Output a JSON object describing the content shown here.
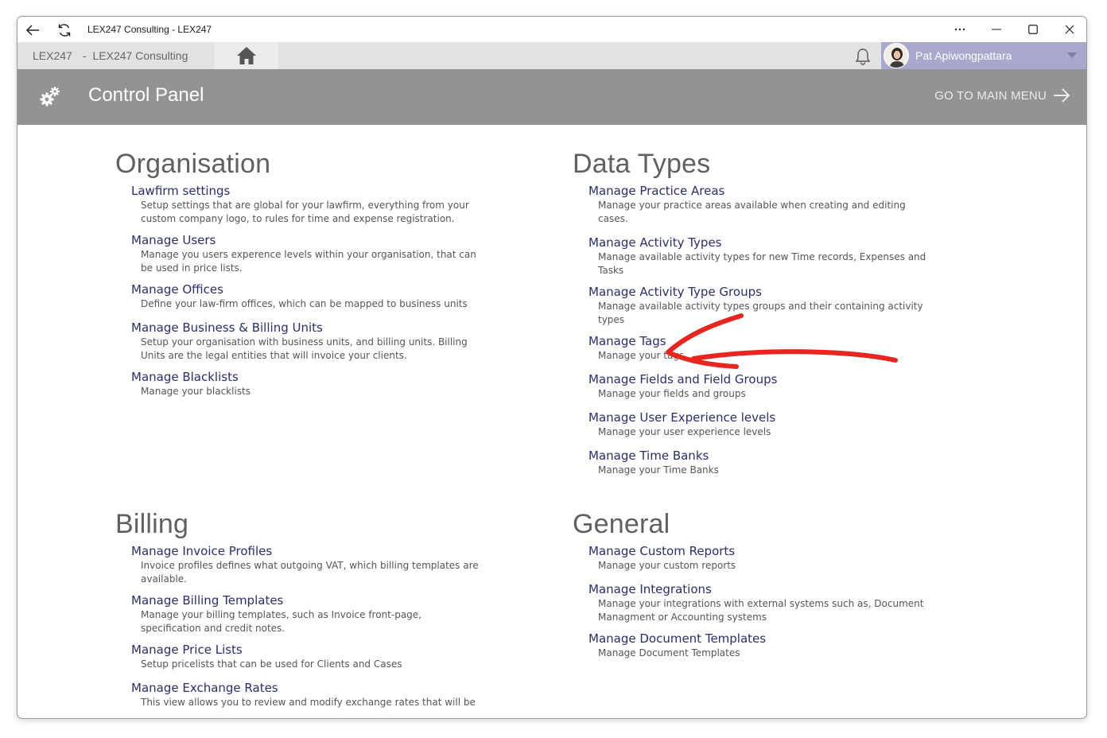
{
  "window": {
    "title": "LEX247 Consulting - LEX247"
  },
  "nav": {
    "breadcrumb_app": "LEX247",
    "breadcrumb_sep": "-",
    "breadcrumb_org": "LEX247 Consulting",
    "user_name": "Pat Apiwongpattara"
  },
  "header": {
    "title": "Control Panel",
    "go_main_menu": "GO TO MAIN MENU"
  },
  "colors": {
    "header_bg": "#939393",
    "user_box_bg": "#a8a8cf",
    "link": "#2a2e6a",
    "annotation": "#e8251e"
  },
  "sections": {
    "organisation": {
      "title": "Organisation",
      "items": [
        {
          "title": "Lawfirm settings",
          "desc": "Setup settings that are global for your lawfirm, everything from your custom company logo, to rules for time and expense registration."
        },
        {
          "title": "Manage Users",
          "desc": "Manage you users experence levels within your organisation, that can be used in price lists."
        },
        {
          "title": "Manage Offices",
          "desc": "Define your law-firm offices, which can be mapped to business units"
        },
        {
          "title": "Manage Business & Billing Units",
          "desc": "Setup your organisation with business units, and billing units. Billing Units are the legal entities that will invoice your clients."
        },
        {
          "title": "Manage Blacklists",
          "desc": "Manage your blacklists"
        }
      ]
    },
    "data_types": {
      "title": "Data Types",
      "items": [
        {
          "title": "Manage Practice Areas",
          "desc": "Manage your practice areas available when creating and editing cases."
        },
        {
          "title": "Manage Activity Types",
          "desc": "Manage available activity types for new Time records, Expenses and Tasks"
        },
        {
          "title": "Manage Activity Type Groups",
          "desc": "Manage available activity types groups and their containing activity types"
        },
        {
          "title": "Manage Tags",
          "desc": "Manage your tags"
        },
        {
          "title": "Manage Fields and Field Groups",
          "desc": "Manage your fields and groups"
        },
        {
          "title": "Manage User Experience levels",
          "desc": "Manage your user experience levels"
        },
        {
          "title": "Manage Time Banks",
          "desc": "Manage your Time Banks"
        }
      ]
    },
    "billing": {
      "title": "Billing",
      "items": [
        {
          "title": "Manage Invoice Profiles",
          "desc": "Invoice profiles defines what outgoing VAT, which billing templates are available."
        },
        {
          "title": "Manage Billing Templates",
          "desc": "Manage your billing templates, such as Invoice front-page, specification and credit notes."
        },
        {
          "title": "Manage Price Lists",
          "desc": "Setup pricelists that can be used for Clients and Cases"
        },
        {
          "title": "Manage Exchange Rates",
          "desc": "This view allows you to review and modify exchange rates that will be"
        }
      ]
    },
    "general": {
      "title": "General",
      "items": [
        {
          "title": "Manage Custom Reports",
          "desc": "Manage your custom reports"
        },
        {
          "title": "Manage Integrations",
          "desc": "Manage your integrations with external systems such as, Document Managment or Accounting systems"
        },
        {
          "title": "Manage Document Templates",
          "desc": "Manage Document Templates"
        }
      ]
    }
  }
}
